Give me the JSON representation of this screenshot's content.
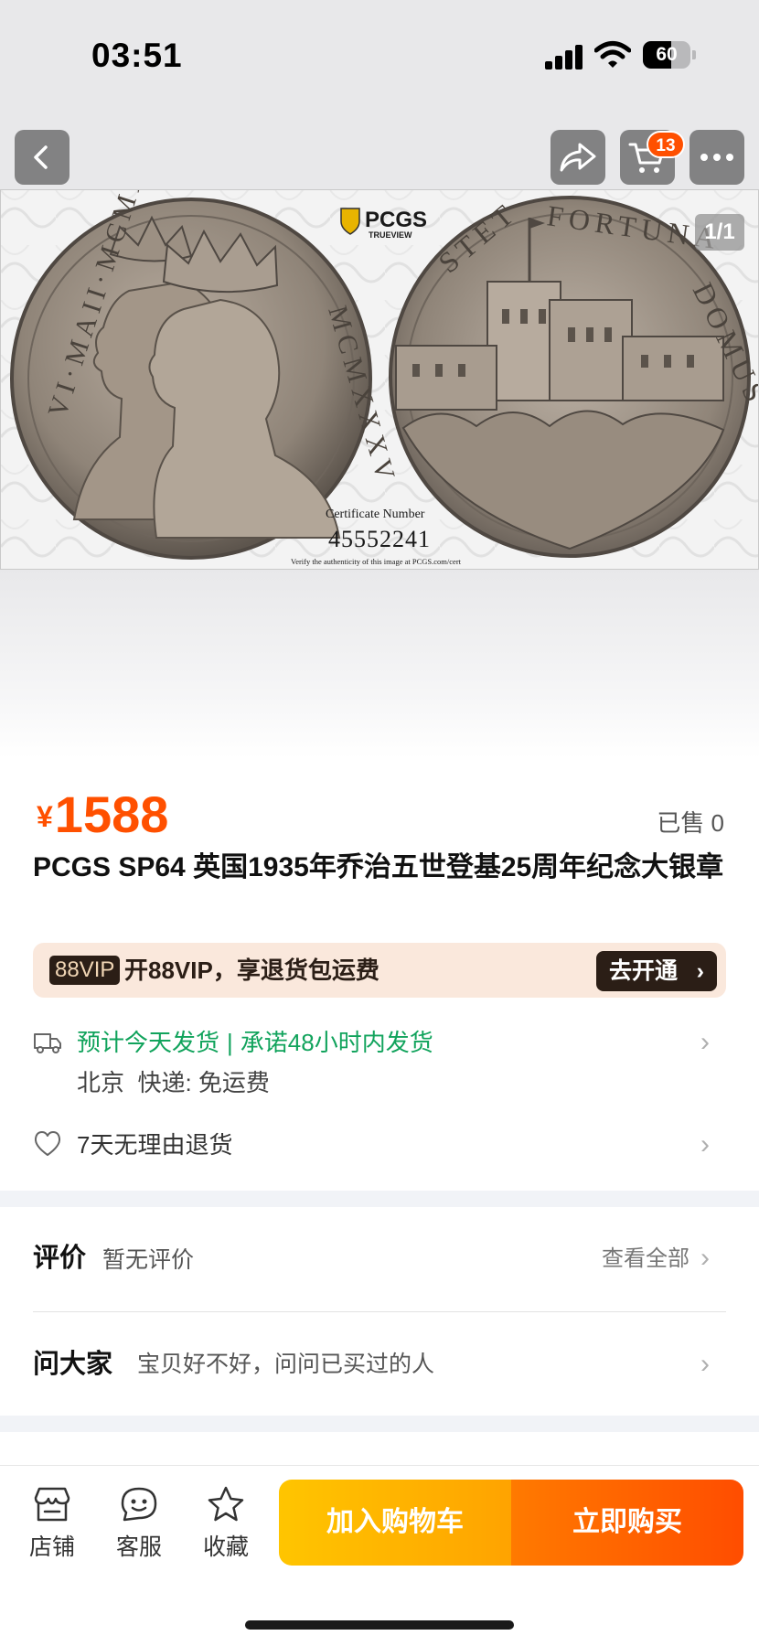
{
  "status_bar": {
    "time": "03:51",
    "battery_level": "60",
    "battery_fraction": 0.6,
    "icons": [
      "signal-icon",
      "wifi-icon",
      "battery-icon"
    ]
  },
  "nav": {
    "back_icon": "chevron-left-icon",
    "share_icon": "share-icon",
    "cart_icon": "cart-icon",
    "cart_badge": "13",
    "more_icon": "more-icon"
  },
  "gallery": {
    "counter": "1/1",
    "brand": "PCGS",
    "brand_sub": "TRUEVIEW",
    "certificate_label": "Certificate Number",
    "certificate_number": "45552241",
    "verify_text": "Verify the authenticity of this image at PCGS.com/cert",
    "obverse_left_legend": "VI·MAII·MCMX",
    "obverse_right_legend": "MCMXXXV",
    "reverse_legend": "STET FORTUNA DOMUS"
  },
  "product": {
    "currency": "¥",
    "price": "1588",
    "sold": "已售 0",
    "title": "PCGS SP64 英国1935年乔治五世登基25周年纪念大银章"
  },
  "vip": {
    "tag": "88VIP",
    "text": "开88VIP，享退货包运费",
    "button": "去开通",
    "button_chevron": "›"
  },
  "shipping": {
    "eta": "预计今天发货",
    "separator": "|",
    "promise": "承诺48小时内发货",
    "origin": "北京",
    "method": "快递: 免运费"
  },
  "returns": {
    "text": "7天无理由退货"
  },
  "reviews": {
    "title": "评价",
    "empty": "暂无评价",
    "view_all": "查看全部"
  },
  "qa": {
    "title": "问大家",
    "prompt": "宝贝好不好，问问已买过的人"
  },
  "bottom_bar": {
    "shop": "店铺",
    "service": "客服",
    "favorite": "收藏",
    "add_to_cart": "加入购物车",
    "buy_now": "立即购买"
  },
  "colors": {
    "accent": "#ff5000",
    "shipping_green": "#11a35c",
    "cart_button": "#ffb300",
    "buy_button": "#ff5a00",
    "vip_bg": "#fae8dc",
    "vip_dark": "#2b1e16"
  }
}
